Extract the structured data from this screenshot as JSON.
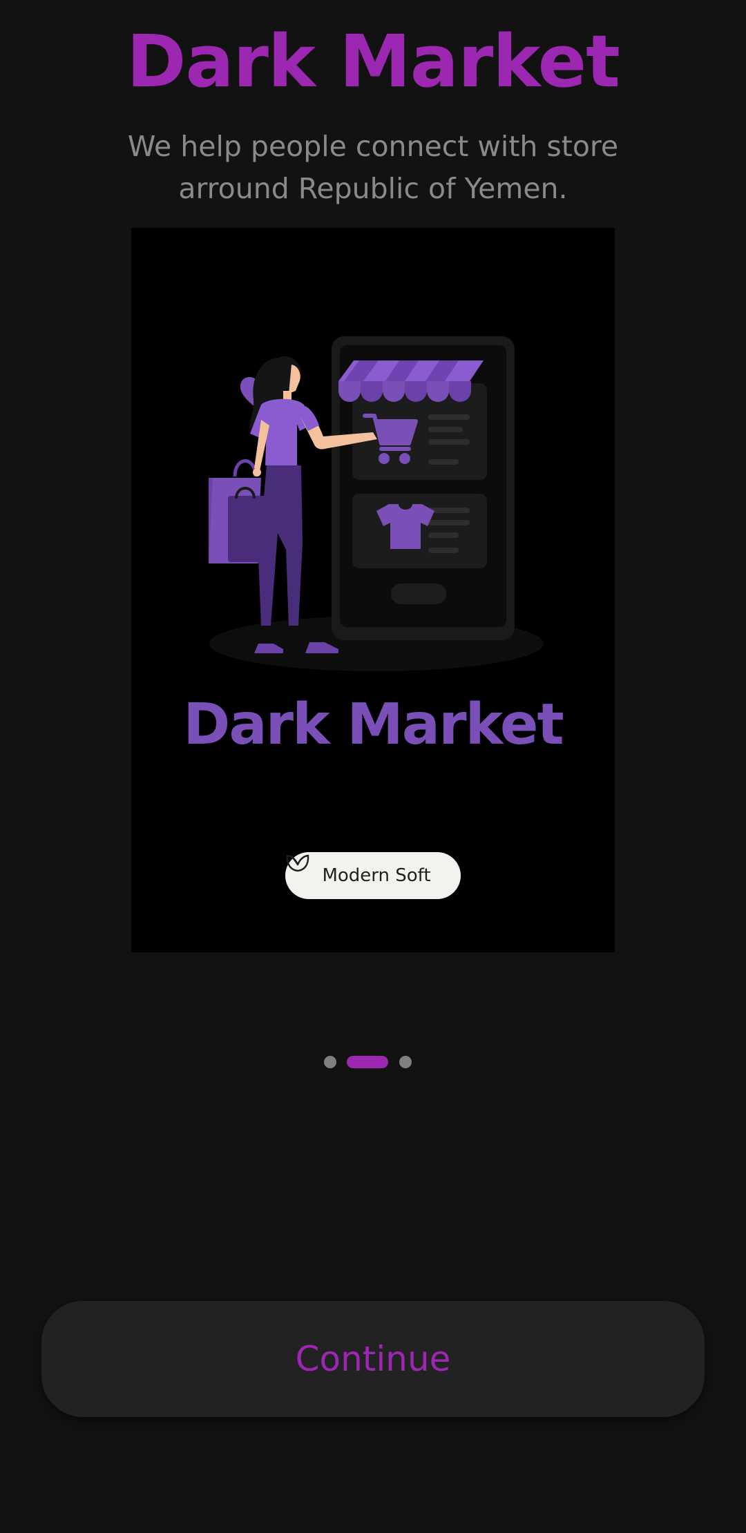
{
  "header": {
    "title": "Dark Market",
    "subtitle": "We help people connect with store arround Republic of Yemen."
  },
  "illustration": {
    "app_name": "Dark Market",
    "brand_label": "Modern Soft",
    "icons": [
      "heart-icon",
      "shopping-cart-icon",
      "t-shirt-icon",
      "shopping-bag-icon",
      "store-awning-icon",
      "modern-soft-logo-icon"
    ]
  },
  "pager": {
    "pages": 3,
    "current_page": 2
  },
  "actions": {
    "continue_label": "Continue"
  },
  "colors": {
    "background": "#121212",
    "accent": "#9c27b0",
    "illustration_purple": "#7b4fb8",
    "subtitle_gray": "#8a8a8a",
    "button_bg": "#222222"
  }
}
